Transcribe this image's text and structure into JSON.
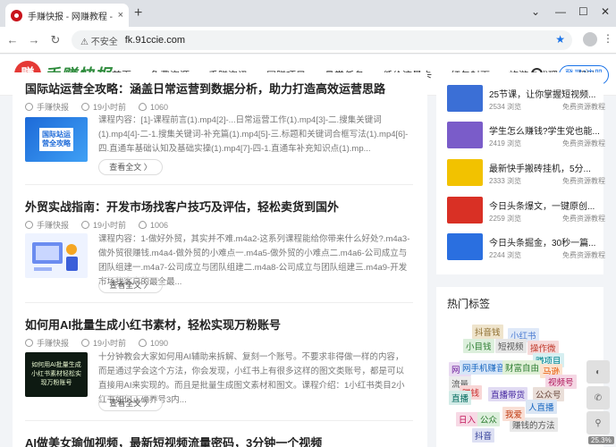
{
  "browser": {
    "tab_title": "手赚快报 - 网赚教程 - 兼职教程",
    "tab_close": "×",
    "new_tab": "+",
    "insecure_label": "⚠ 不安全",
    "url": "fk.91ccie.com"
  },
  "site": {
    "logo_badge": "赚",
    "logo_text": "手赚快报",
    "nav": [
      "首页",
      "免费资源",
      "手赚资讯",
      "网赚项目",
      "悬赏任务",
      "低价流量卡",
      "红包封面",
      "旅游卡代理",
      "帮助"
    ],
    "login_label": "登录/注册"
  },
  "articles": [
    {
      "title": "国际站运营全攻略：涵盖日常运营到数据分析，助力打造高效运营思路",
      "author": "手赚快报",
      "time": "19小时前",
      "views": "1060",
      "thumb_text": "国际站运营全攻略",
      "excerpt": "课程内容：[1]-课程前言(1).mp4[2]-...日常运营工作(1).mp4[3]-二.搜集关键词(1).mp4[4]-二-1.搜集关键词-补充篇(1).mp4[5]-三.标题和关键词合框写法(1).mp4[6]-四.直通车基础认知及基础实操(1).mp4[7]-四-1.直通车补充知识点(1).mp...",
      "read_label": "查看全文 〉"
    },
    {
      "title": "外贸实战指南：开发市场找客户技巧及评估，轻松卖货到国外",
      "author": "手赚快报",
      "time": "19小时前",
      "views": "1006",
      "thumb_text": "",
      "excerpt": "课程内容：1-做好外贸，其实并不难.m4a2-这系列课程能给你带来什么好处?.m4a3-做外贸很赚钱.m4a4-做外贸的小难点一.m4a5-做外贸的小难点二.m4a6-公司成立与团队组建一.m4a7-公司成立与团队组建二.m4a8-公司成立与团队组建三.m4a9-开发市场找客户的最全最...",
      "read_label": "查看全文 〉"
    },
    {
      "title": "如何用AI批量生成小红书素材，轻松实现万粉账号",
      "author": "手赚快报",
      "time": "19小时前",
      "views": "1090",
      "thumb_text": "如何用AI批量生成小红书素材轻松实现万粉账号",
      "excerpt": "十分钟教会大家如何用AI辅助来拆解、复刻一个账号。不要求非得做一样的内容，而是通过学会这个方法，你会发现，小红书上有很多这样的图文类账号，都是可以直接用AI来实现的。而且是批量生成图文素材和图文。课程介绍：1小红书类目2小红书如何正确养号3内...",
      "read_label": "查看全文 〉"
    },
    {
      "title": "AI做美女瑜伽视频，最新短视频流量密码，3分钟一个视频"
    }
  ],
  "sidebar": {
    "items": [
      {
        "title": "25节课，让你掌握短视频...",
        "views": "2534 浏览",
        "source": "免费资源教程",
        "color": "#3b6fd6"
      },
      {
        "title": "学生怎么赚钱?学生党也能...",
        "views": "2419 浏览",
        "source": "免费资源教程",
        "color": "#7a5cc9"
      },
      {
        "title": "最新快手搬砖挂机，5分...",
        "views": "2333 浏览",
        "source": "免费资源教程",
        "color": "#f2c200"
      },
      {
        "title": "今日头条爆文，一键原创...",
        "views": "2259 浏览",
        "source": "免费资源教程",
        "color": "#d93025"
      },
      {
        "title": "今日头条掘金，30秒一篇...",
        "views": "2244 浏览",
        "source": "免费资源教程",
        "color": "#2a6fe0"
      }
    ]
  },
  "tags": {
    "title": "热门标签",
    "items": [
      {
        "text": "小红书",
        "color": "#4a7bd1",
        "bg": "#dfe9f8"
      },
      {
        "text": "抖音钱",
        "color": "#8a6a2a",
        "bg": "#efe4cc"
      },
      {
        "text": "小目钱",
        "color": "#2e7d32",
        "bg": "#dcefdc"
      },
      {
        "text": "短视频",
        "color": "#555",
        "bg": "#e6e6e6"
      },
      {
        "text": "操作微",
        "color": "#c0392b",
        "bg": "#f6dada"
      },
      {
        "text": "网赚",
        "color": "#6a1b9a",
        "bg": "#eadcf2"
      },
      {
        "text": "赚项目",
        "color": "#00838f",
        "bg": "#d6eff1"
      },
      {
        "text": "网手机赚音",
        "color": "#1565c0",
        "bg": "#d7e6f8"
      },
      {
        "text": "财富自由",
        "color": "#2e7d32",
        "bg": "#e0f0d8"
      },
      {
        "text": "马逊",
        "color": "#e65100",
        "bg": "#fbe3cf"
      },
      {
        "text": "视频号",
        "color": "#ad1457",
        "bg": "#f5d7e4"
      },
      {
        "text": "流量",
        "color": "#555",
        "bg": "#ececec"
      },
      {
        "text": "赚钱",
        "color": "#c62828",
        "bg": "#f8d6d6"
      },
      {
        "text": "直播带货",
        "color": "#4527a0",
        "bg": "#e1dbf3"
      },
      {
        "text": "直播",
        "color": "#00695c",
        "bg": "#d4ece8"
      },
      {
        "text": "公众号",
        "color": "#6d4c41",
        "bg": "#eadfd9"
      },
      {
        "text": "人直播",
        "color": "#1565c0",
        "bg": "#dbe6f4"
      },
      {
        "text": "日入",
        "color": "#c2185b",
        "bg": "#f7d9e5"
      },
      {
        "text": "公众",
        "color": "#2e7d32",
        "bg": "#dcefdc"
      },
      {
        "text": "赚钱的方法",
        "color": "#555",
        "bg": "#e8e8e8"
      },
      {
        "text": "抖音",
        "color": "#283593",
        "bg": "#dde0f3"
      },
      {
        "text": "我爱",
        "color": "#bf360c",
        "bg": "#f9dfd5"
      }
    ]
  },
  "floating": {
    "btn1": "◐",
    "btn2": "✆",
    "btn3": "⚲",
    "zoom": "25.3%"
  }
}
